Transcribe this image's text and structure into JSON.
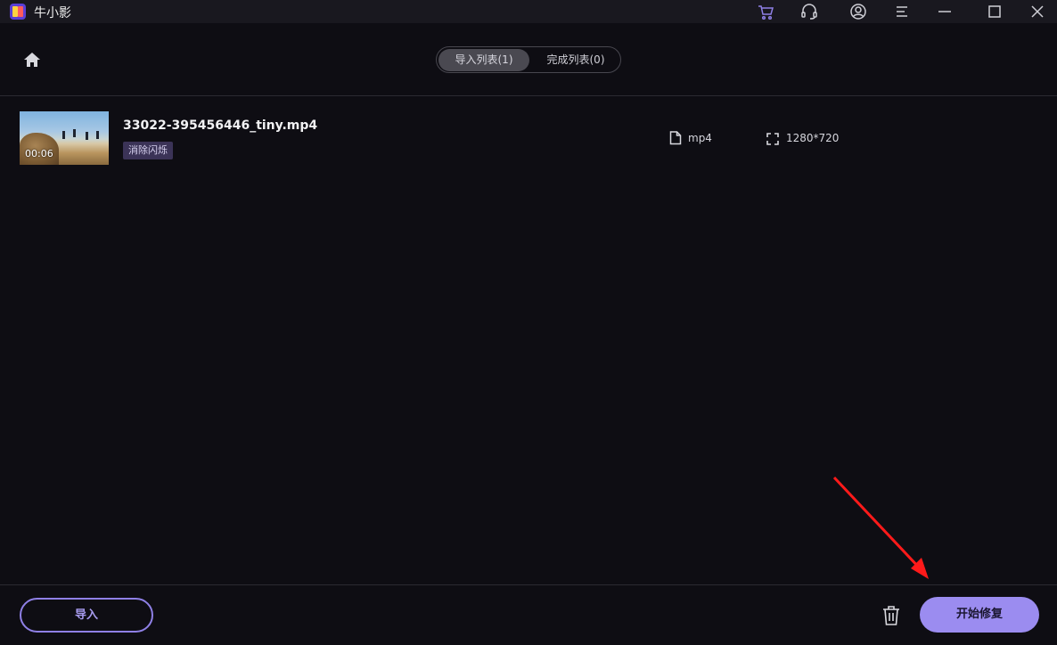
{
  "app": {
    "title": "牛小影",
    "logo_icon": "app-logo-icon"
  },
  "titlebar": {
    "icons": [
      "cart-icon",
      "headset-icon",
      "user-icon",
      "menu-icon",
      "minimize-icon",
      "maximize-icon",
      "close-icon"
    ],
    "cart_color": "#8f80e6"
  },
  "nav": {
    "home_icon": "home-icon"
  },
  "tabs": {
    "import_label": "导入列表(1)",
    "done_label": "完成列表(0)",
    "active": "import"
  },
  "files": [
    {
      "name": "33022-395456446_tiny.mp4",
      "duration": "00:06",
      "tag": "消除闪烁",
      "format": "mp4",
      "resolution": "1280*720"
    }
  ],
  "footer": {
    "import_label": "导入",
    "start_label": "开始修复",
    "trash_icon": "trash-icon",
    "accent": "#9b8cf0"
  },
  "annotation": {
    "arrow_color": "#ff1a1a"
  }
}
